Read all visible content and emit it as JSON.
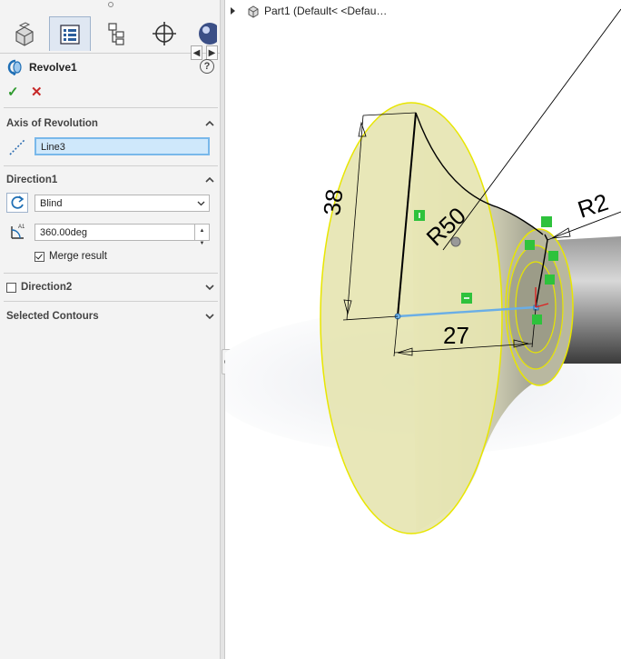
{
  "panel": {
    "tabs": [
      {
        "icon": "part-icon"
      },
      {
        "icon": "property-manager-icon",
        "active": true
      },
      {
        "icon": "configuration-icon"
      },
      {
        "icon": "dimxpert-icon"
      },
      {
        "icon": "appearance-icon"
      }
    ],
    "feature": {
      "title": "Revolve1",
      "icon": "revolve-icon",
      "help": "?"
    },
    "actions": {
      "ok": "✓",
      "cancel": "✕"
    },
    "axis_section": {
      "title": "Axis of Revolution",
      "value": "Line3"
    },
    "direction1": {
      "title": "Direction1",
      "type": "Blind",
      "angle": "360.00deg",
      "merge_label": "Merge result",
      "merge_checked": true
    },
    "direction2": {
      "title": "Direction2",
      "checked": false
    },
    "selected_contours": {
      "title": "Selected Contours"
    }
  },
  "tree": {
    "label": "Part1  (Default< <Defau…"
  },
  "sketch": {
    "dims": {
      "d38": "38",
      "d27": "27",
      "r50": "R50",
      "r2": "R2"
    }
  },
  "colors": {
    "accent": "#79b8ea",
    "face": "#e6e4b0",
    "outline": "#e8e600",
    "body": "#8a8a8a"
  }
}
